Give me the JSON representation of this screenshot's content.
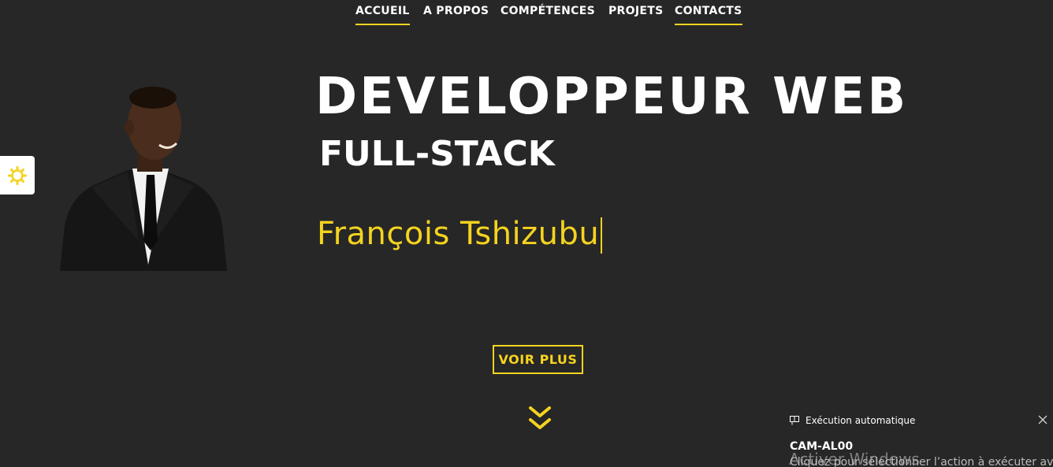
{
  "nav": {
    "items": [
      {
        "label": "ACCUEIL"
      },
      {
        "label": "A PROPOS"
      },
      {
        "label": "COMPÉTENCES"
      },
      {
        "label": "PROJETS"
      },
      {
        "label": "CONTACTS"
      }
    ]
  },
  "theme_toggle": {
    "icon": "sun-icon"
  },
  "hero": {
    "title": "DEVELOPPEUR WEB",
    "subtitle": "FULL-STACK",
    "name": "François Tshizubu",
    "button_label": "VOIR PLUS",
    "scroll_icon": "double-chevron-down-icon"
  },
  "toast": {
    "header": "Exécution automatique",
    "title": "CAM-AL00",
    "body": "Cliquez pour sélectionner l’action à exécuter avec"
  },
  "watermark": "Activer Windows",
  "colors": {
    "background": "#272727",
    "accent": "#f5d31f",
    "text": "#ffffff"
  }
}
